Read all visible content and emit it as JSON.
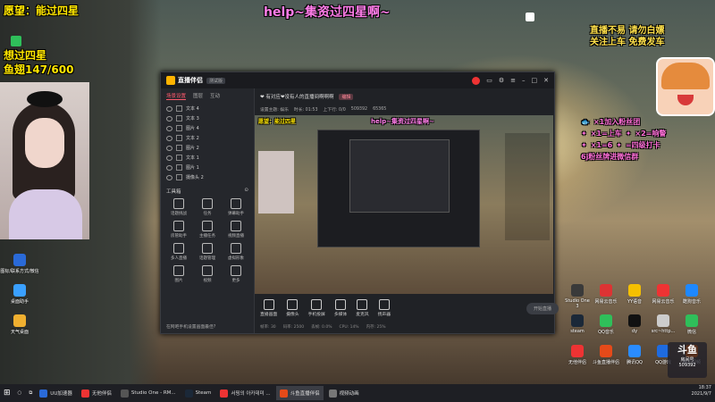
{
  "overlay": {
    "title": "help~集资过四星啊~",
    "wish": "愿望：能过四星",
    "goal_line1": "想过四星",
    "goal_line2": "鱼翅147/600",
    "rules_line1": "直播不易 请勿白嫖",
    "rules_line2": "关注上车 免费发车",
    "gifts": [
      {
        "text": "×1加入粉丝团"
      },
      {
        "text": "×1=上车",
        "text2": "×2=响警"
      },
      {
        "text": "×1=6",
        "text2": "=四级打卡"
      },
      {
        "text": "6j粉丝牌进微信群"
      }
    ]
  },
  "left_desktop_icons": [
    {
      "label": "图标/联系方式/微信",
      "color": "#2a6ad8"
    },
    {
      "label": "桌面助手",
      "color": "#3aa0ff"
    },
    {
      "label": "天气桌面",
      "color": "#f0b030"
    }
  ],
  "right_desktop_icons": [
    {
      "label": "Studio One 3",
      "color": "#3a3a3a"
    },
    {
      "label": "网易云音乐",
      "color": "#d33"
    },
    {
      "label": "YY语音",
      "color": "#f5c000"
    },
    {
      "label": "网易云音乐",
      "color": "#e33"
    },
    {
      "label": "酷狗音乐",
      "color": "#1e88ff"
    },
    {
      "label": "steam",
      "color": "#1b2838"
    },
    {
      "label": "QQ音乐",
      "color": "#2fbf5a"
    },
    {
      "label": "dy",
      "color": "#111"
    },
    {
      "label": "src~http...",
      "color": "#ccc"
    },
    {
      "label": "微信",
      "color": "#2fbf5a"
    },
    {
      "label": "无他伴侣",
      "color": "#e33"
    },
    {
      "label": "斗鱼直播伴侣",
      "color": "#e64a19"
    },
    {
      "label": "腾讯QQ",
      "color": "#2a8cff"
    },
    {
      "label": "QQ游戏",
      "color": "#1e6be0"
    },
    {
      "label": "腾讯视频",
      "color": "#ff6a00"
    }
  ],
  "app": {
    "name": "直播伴侣",
    "badge": "测试版",
    "side_tabs": [
      "场景设置",
      "图层",
      "互动"
    ],
    "scenes": [
      "文本 4",
      "文本 3",
      "图片 4",
      "文本 2",
      "图片 2",
      "文本 1",
      "图片 1",
      "摄像头 2"
    ],
    "tools_title": "工具箱",
    "tools": [
      "话题挑战",
      "任务",
      "弹幕助手",
      "房管助手",
      "主播任务",
      "视频直播",
      "多人直播",
      "话题管理",
      "虚拟形象",
      "图片",
      "视频",
      "更多"
    ],
    "tip": "在网吧手机设置画面最佳?",
    "stream_title": "❤ 有对应❤没有人的直播间啊啊啊",
    "stream_tag": "编辑",
    "stats": [
      "设置主题: 娱乐",
      "时长: 01:53",
      "上下行: 0/0",
      "509392",
      "65365"
    ],
    "bottom_buttons": [
      "直播画面",
      "摄像头",
      "手机投屏",
      "多媒体",
      "麦克风",
      "扬声器"
    ],
    "start_button": "开始直播",
    "status": [
      "帧率: 30",
      "码率: 2500",
      "丢帧: 0.0%",
      "CPU: 14%",
      "内存: 25%"
    ]
  },
  "taskbar": [
    {
      "label": "UU加速器",
      "color": "#2a6ad8"
    },
    {
      "label": "无他伴侣",
      "color": "#e33"
    },
    {
      "label": "Studio One - RM...",
      "color": "#555"
    },
    {
      "label": "Steam",
      "color": "#1b2838"
    },
    {
      "label": "서핑의 아카데미 ...",
      "color": "#e33"
    },
    {
      "label": "斗鱼直播伴侣",
      "color": "#e64a19",
      "active": true
    },
    {
      "label": "视频动画",
      "color": "#777"
    }
  ],
  "douyu": {
    "label": "斗鱼",
    "sub": "房间号",
    "room": "509392"
  },
  "clock": {
    "time": "18:37",
    "date": "2021/9/7"
  }
}
